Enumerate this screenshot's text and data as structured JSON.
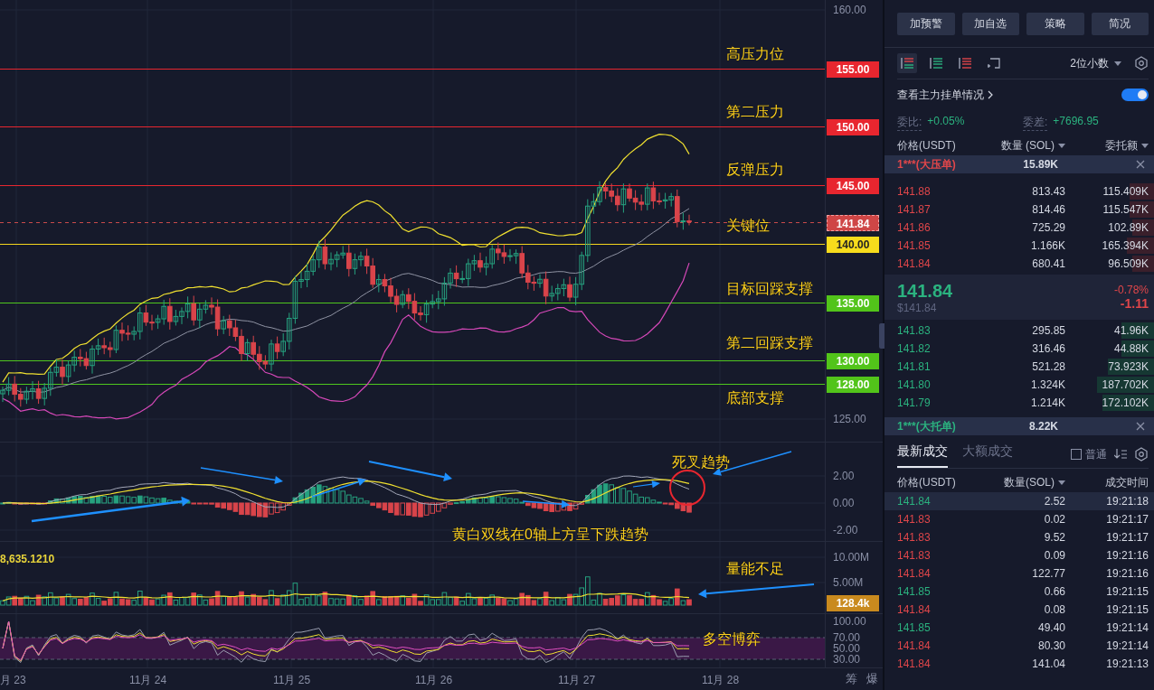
{
  "chart": {
    "price_ticks": [
      "160.00",
      "125.00"
    ],
    "levels": [
      {
        "price": "155.00",
        "kind": "resistance",
        "note": "高压力位"
      },
      {
        "price": "150.00",
        "kind": "resistance",
        "note": "第二压力"
      },
      {
        "price": "145.00",
        "kind": "resistance",
        "note": "反弹压力"
      },
      {
        "price": "141.84",
        "kind": "last",
        "note": "关键位"
      },
      {
        "price": "140.00",
        "kind": "key"
      },
      {
        "price": "135.00",
        "kind": "support",
        "note": "目标回踩支撑"
      },
      {
        "price": "130.00",
        "kind": "support",
        "note": "第二回踩支撑"
      },
      {
        "price": "128.00",
        "kind": "support",
        "note": "底部支撑"
      }
    ],
    "macd": {
      "ticks": [
        "2.00",
        "0.00",
        "-2.00"
      ],
      "cross_note": "死叉趋势",
      "trend_note": "黄白双线在0轴上方呈下跌趋势"
    },
    "volume": {
      "value": "8,635.1210",
      "ticks": [
        "10.00M",
        "5.00M"
      ],
      "current": "128.4k",
      "note": "量能不足"
    },
    "rsi": {
      "ticks": [
        "100.00",
        "70.00",
        "50.00",
        "30.00"
      ],
      "note": "多空博弈"
    },
    "dates": [
      "月 23",
      "11月 24",
      "11月 25",
      "11月 26",
      "11月 27",
      "11月 28"
    ],
    "axis_buttons": [
      "筹",
      "爆"
    ]
  },
  "panel": {
    "actions": [
      "加预警",
      "加自选",
      "策略",
      "简况"
    ],
    "view_modes": [
      {
        "kind": "both",
        "selected": true
      },
      {
        "kind": "bids",
        "selected": false
      },
      {
        "kind": "asks",
        "selected": false
      },
      {
        "kind": "custom",
        "selected": false
      }
    ],
    "precision": "2位小数",
    "main_orders": {
      "label": "查看主力挂单情况",
      "on": true
    },
    "ratio": {
      "label": "委比:",
      "value": "+0.05%"
    },
    "diff": {
      "label": "委差:",
      "value": "+7696.95"
    },
    "book_columns": [
      {
        "label": "价格(USDT)",
        "sortable": false
      },
      {
        "label": "数量 (SOL)",
        "sortable": true
      },
      {
        "label": "委托额",
        "sortable": true
      }
    ],
    "big_ask": {
      "label": "1***(大压单)",
      "amount": "15.89K"
    },
    "asks": [
      {
        "price": "141.88",
        "amount": "813.43",
        "total": "115.409K",
        "level": 0.09
      },
      {
        "price": "141.87",
        "amount": "814.46",
        "total": "115.547K",
        "level": 0.09
      },
      {
        "price": "141.86",
        "amount": "725.29",
        "total": "102.89K",
        "level": 0.08
      },
      {
        "price": "141.85",
        "amount": "1.166K",
        "total": "165.394K",
        "level": 0.1
      },
      {
        "price": "141.84",
        "amount": "680.41",
        "total": "96.509K",
        "level": 0.08
      }
    ],
    "last": {
      "price": "141.84",
      "usd": "$141.84",
      "change_pct": "-0.78%",
      "change": "-1.11"
    },
    "bids": [
      {
        "price": "141.83",
        "amount": "295.85",
        "total": "41.96K",
        "level": 0.12
      },
      {
        "price": "141.82",
        "amount": "316.46",
        "total": "44.88K",
        "level": 0.12
      },
      {
        "price": "141.81",
        "amount": "521.28",
        "total": "73.923K",
        "level": 0.17
      },
      {
        "price": "141.80",
        "amount": "1.324K",
        "total": "187.702K",
        "level": 0.21
      },
      {
        "price": "141.79",
        "amount": "1.214K",
        "total": "172.102K",
        "level": 0.19
      }
    ],
    "big_bid": {
      "label": "1***(大托单)",
      "amount": "8.22K"
    },
    "trade_tabs": [
      {
        "label": "最新成交",
        "selected": true
      },
      {
        "label": "大额成交",
        "selected": false
      }
    ],
    "normal_filter": {
      "label": "普通",
      "checked": false
    },
    "trade_columns": [
      {
        "label": "价格(USDT)",
        "sortable": false
      },
      {
        "label": "数量(SOL)",
        "sortable": true
      },
      {
        "label": "成交时间",
        "sortable": false
      }
    ],
    "trades": [
      {
        "price": "141.84",
        "amount": "2.52",
        "time": "19:21:18",
        "color": "#2bb27f",
        "selected": true
      },
      {
        "price": "141.83",
        "amount": "0.02",
        "time": "19:21:17",
        "color": "#e0464a",
        "selected": false
      },
      {
        "price": "141.83",
        "amount": "9.52",
        "time": "19:21:17",
        "color": "#e0464a",
        "selected": false
      },
      {
        "price": "141.83",
        "amount": "0.09",
        "time": "19:21:16",
        "color": "#e0464a",
        "selected": false
      },
      {
        "price": "141.84",
        "amount": "122.77",
        "time": "19:21:16",
        "color": "#e0464a",
        "selected": false
      },
      {
        "price": "141.85",
        "amount": "0.66",
        "time": "19:21:15",
        "color": "#2bb27f",
        "selected": false
      },
      {
        "price": "141.84",
        "amount": "0.08",
        "time": "19:21:15",
        "color": "#e0464a",
        "selected": false
      },
      {
        "price": "141.85",
        "amount": "49.40",
        "time": "19:21:14",
        "color": "#2bb27f",
        "selected": false
      },
      {
        "price": "141.84",
        "amount": "80.30",
        "time": "19:21:14",
        "color": "#e0464a",
        "selected": false
      },
      {
        "price": "141.84",
        "amount": "141.04",
        "time": "19:21:13",
        "color": "#e0464a",
        "selected": false
      }
    ]
  }
}
